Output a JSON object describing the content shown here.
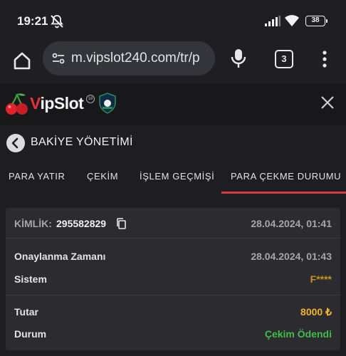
{
  "status": {
    "time": "19:21",
    "battery": "38"
  },
  "browser": {
    "url": "m.vipslot240.com/tr/p",
    "tab_count": "3"
  },
  "header": {
    "logo_prefix": "V",
    "logo_rest": "ipSlot",
    "logo_badge": "18"
  },
  "panel": {
    "title": "BAKİYE YÖNETİMİ",
    "tabs": [
      "PARA YATIR",
      "ÇEKİM",
      "İŞLEM GEÇMİŞİ",
      "PARA ÇEKME DURUMU"
    ],
    "active_tab": "PARA ÇEKME DURUMU"
  },
  "withdrawal": {
    "id_label": "KİMLİK:",
    "id_value": "295582829",
    "created_at": "28.04.2024, 01:41",
    "approved_label": "Onaylanma Zamanı",
    "approved_at": "28.04.2024, 01:43",
    "system_label": "Sistem",
    "system_value": "F****",
    "amount_label": "Tutar",
    "amount_value": "8000 ₺",
    "status_label": "Durum",
    "status_value": "Çekim Ödendi"
  },
  "colors": {
    "accent": "#d63a45",
    "amount": "#f2b42a",
    "system": "#c8941e",
    "status_ok": "#3fbf4a"
  }
}
